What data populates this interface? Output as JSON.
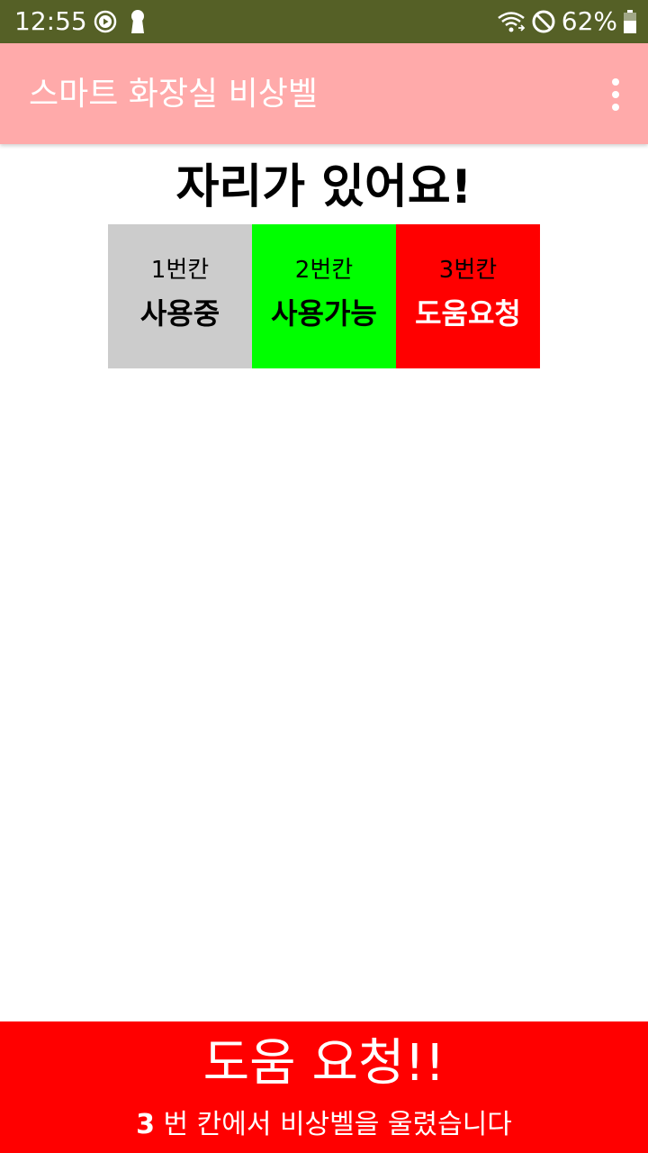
{
  "status_bar": {
    "time": "12:55",
    "battery": "62%",
    "left_icons": [
      "media-play-icon",
      "keyhole-icon"
    ],
    "right_icons": [
      "wifi-icon",
      "do-not-disturb-icon",
      "battery-icon"
    ]
  },
  "app_bar": {
    "title": "스마트 화장실 비상벨",
    "menu_icon": "more-vert-icon",
    "color": "#ffaaaa"
  },
  "headline": "자리가 있어요!",
  "stalls": [
    {
      "name": "1번칸",
      "status": "사용중",
      "bg": "#cccccc",
      "status_color": "#000000"
    },
    {
      "name": "2번칸",
      "status": "사용가능",
      "bg": "#00ff00",
      "status_color": "#000000"
    },
    {
      "name": "3번칸",
      "status": "도움요청",
      "bg": "#ff0000",
      "status_color": "#ffffff"
    }
  ],
  "alert": {
    "title": "도움 요청!!",
    "stall_number": "3",
    "message": " 번 칸에서 비상벨을 울렸습니다",
    "bg": "#ff0000"
  }
}
